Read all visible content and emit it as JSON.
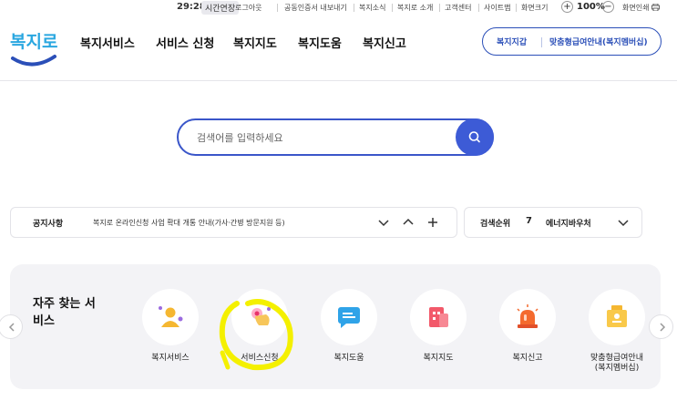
{
  "utility": {
    "timer": "29:28",
    "extend_label": "시간연장",
    "links": [
      "로그아웃",
      "공동인증서 내보내기",
      "복지소식",
      "복지로 소개",
      "고객센터",
      "사이트맵",
      "화면크기"
    ],
    "zoom_in": "+",
    "zoom_value": "100%",
    "zoom_out": "−",
    "print_label": "화면인쇄"
  },
  "header": {
    "logo_text": "복지로",
    "nav": [
      "복지서비스",
      "서비스 신청",
      "복지지도",
      "복지도움",
      "복지신고"
    ],
    "quick_links": [
      "복지지갑",
      "맞춤형급여안내(복지멤버십)"
    ]
  },
  "search": {
    "placeholder": "검색어를 입력하세요",
    "icon": "search-icon"
  },
  "notice": {
    "label": "공지사항",
    "text": "복지로 온라인신청 사업 확대 개통 안내(가사·간병 방문지원 등)"
  },
  "rank": {
    "label": "검색순위",
    "number": "7",
    "keyword": "에너지바우처"
  },
  "frequent": {
    "title": "자주 찾는 서비스",
    "items": [
      {
        "label": "복지서비스",
        "icon": "person-icon"
      },
      {
        "label": "서비스신청",
        "icon": "hand-click-icon"
      },
      {
        "label": "복지도움",
        "icon": "chat-bubble-icon"
      },
      {
        "label": "복지지도",
        "icon": "building-map-icon"
      },
      {
        "label": "복지신고",
        "icon": "siren-icon"
      },
      {
        "label": "맞춤형급여안내\n(복지멤버십)",
        "icon": "membership-badge-icon"
      }
    ]
  },
  "colors": {
    "brand_blue": "#3a56c9",
    "highlight": "#f4f000",
    "panel_bg": "#f3f3f6"
  }
}
